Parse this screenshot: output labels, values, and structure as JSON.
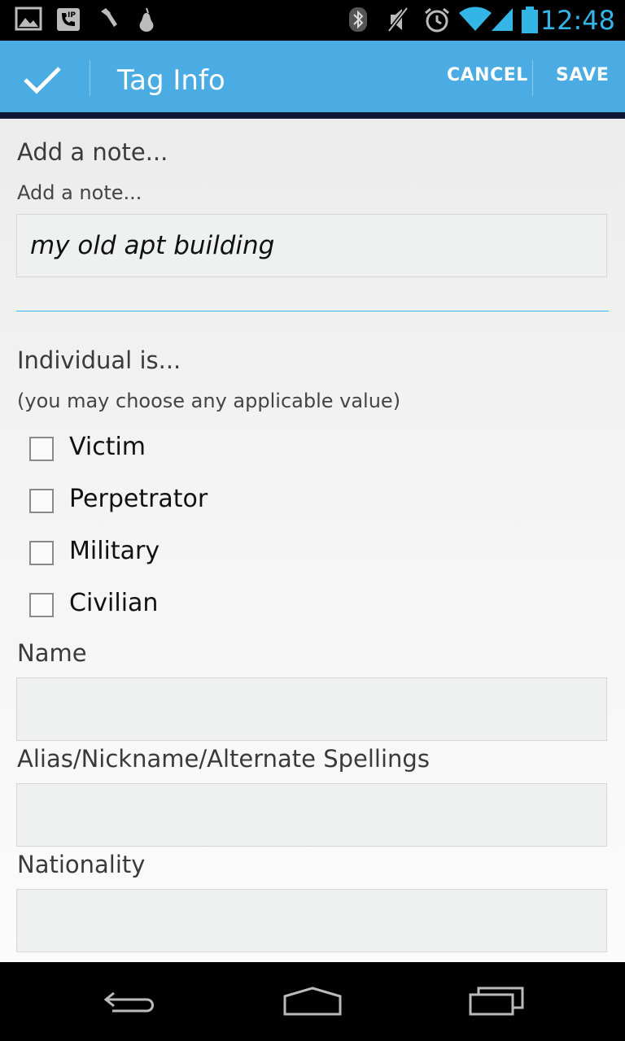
{
  "status_bar": {
    "time": "12:48",
    "icons": [
      "image-icon",
      "sip-phone-icon",
      "flashlight-icon",
      "pear-icon",
      "bluetooth-icon",
      "mute-icon",
      "alarm-icon",
      "wifi-icon",
      "signal-icon",
      "battery-icon"
    ],
    "accent_color": "#33b5e5"
  },
  "action_bar": {
    "title": "Tag Info",
    "cancel_label": "CANCEL",
    "save_label": "SAVE",
    "background_color": "#4aace2"
  },
  "form": {
    "note_heading": "Add a note...",
    "note_label": "Add a note...",
    "note_value": "my old apt building",
    "individual_heading": "Individual is...",
    "individual_hint": "(you may choose any applicable value)",
    "options": [
      {
        "label": "Victim",
        "checked": false
      },
      {
        "label": "Perpetrator",
        "checked": false
      },
      {
        "label": "Military",
        "checked": false
      },
      {
        "label": "Civilian",
        "checked": false
      }
    ],
    "name_label": "Name",
    "name_value": "",
    "alias_label": "Alias/Nickname/Alternate Spellings",
    "alias_value": "",
    "nationality_label": "Nationality",
    "nationality_value": ""
  },
  "nav_bar": {
    "icons": [
      "back-icon",
      "home-icon",
      "recent-apps-icon"
    ]
  }
}
